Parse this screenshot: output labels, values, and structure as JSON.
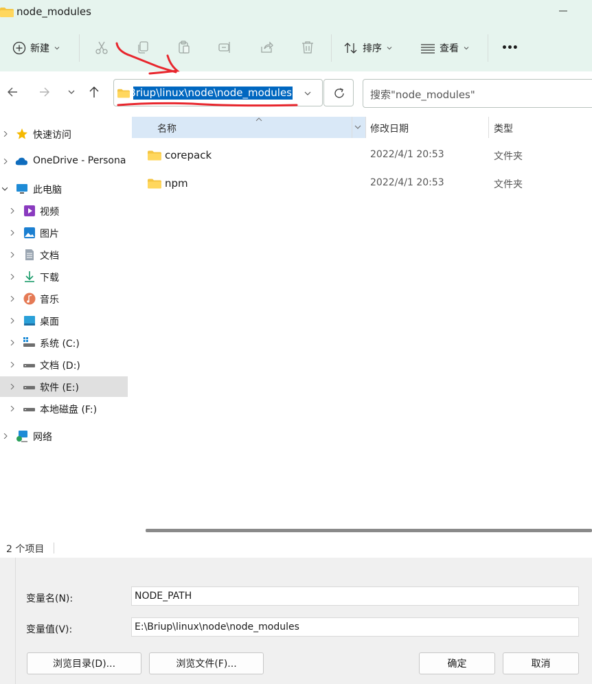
{
  "window": {
    "title": "node_modules"
  },
  "toolbar": {
    "new_label": "新建",
    "sort_label": "排序",
    "view_label": "查看",
    "more_label": "•••"
  },
  "address": {
    "path_visible": "E:\\Briup\\linux\\node\\node_modules",
    "search_placeholder": "搜索\"node_modules\""
  },
  "sidebar": {
    "items": [
      {
        "label": "快速访问",
        "icon": "star-icon"
      },
      {
        "label": "OneDrive - Persona",
        "icon": "cloud-icon"
      },
      {
        "label": "此电脑",
        "icon": "monitor-icon"
      },
      {
        "label": "视频",
        "icon": "video-icon"
      },
      {
        "label": "图片",
        "icon": "picture-icon"
      },
      {
        "label": "文档",
        "icon": "document-icon"
      },
      {
        "label": "下载",
        "icon": "download-icon"
      },
      {
        "label": "音乐",
        "icon": "music-icon"
      },
      {
        "label": "桌面",
        "icon": "desktop-icon"
      },
      {
        "label": "系统 (C:)",
        "icon": "drive-icon"
      },
      {
        "label": "文档 (D:)",
        "icon": "drive-icon"
      },
      {
        "label": "软件 (E:)",
        "icon": "drive-icon"
      },
      {
        "label": "本地磁盘 (F:)",
        "icon": "drive-icon"
      },
      {
        "label": "网络",
        "icon": "network-icon"
      }
    ]
  },
  "columns": {
    "name": "名称",
    "date": "修改日期",
    "type": "类型"
  },
  "files": [
    {
      "name": "corepack",
      "date": "2022/4/1 20:53",
      "type": "文件夹"
    },
    {
      "name": "npm",
      "date": "2022/4/1 20:53",
      "type": "文件夹"
    }
  ],
  "status": {
    "count": "2 个项目"
  },
  "dialog": {
    "var_name_label": "变量名(N):",
    "var_name_value": "NODE_PATH",
    "var_value_label": "变量值(V):",
    "var_value_value": "E:\\Briup\\linux\\node\\node_modules",
    "browse_dir": "浏览目录(D)...",
    "browse_file": "浏览文件(F)...",
    "ok": "确定",
    "cancel": "取消"
  },
  "colors": {
    "selection": "#0067c0",
    "toolbar_bg": "#e6f4ee",
    "annotation": "#e8262d"
  }
}
